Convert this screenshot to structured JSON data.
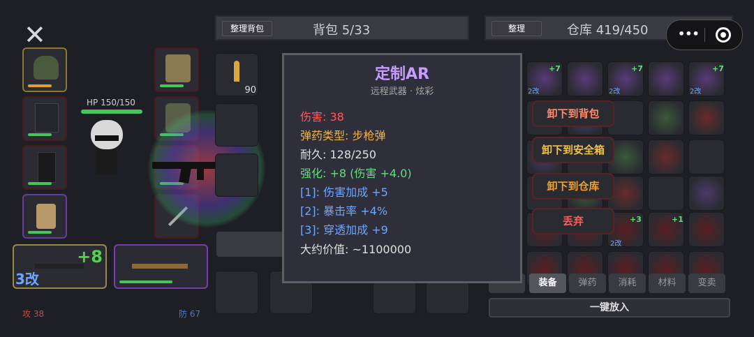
{
  "close_label": "✕",
  "hp_text": "HP 150/150",
  "hp_fraction": 1.0,
  "attack_text": "攻 38",
  "defense_text": "防 67",
  "weapon_slot1": {
    "upgrade": "+8",
    "mods": "3改"
  },
  "backpack": {
    "sort_label": "整理背包",
    "title": "背包 5/33",
    "ammo_count": "90"
  },
  "warehouse": {
    "sort_label": "整理",
    "title": "仓库 419/450"
  },
  "miniapp_more": "•••",
  "tooltip": {
    "name": "定制AR",
    "subtitle": "远程武器 · 炫彩",
    "damage": "伤害: 38",
    "ammo_type": "弹药类型: 步枪弹",
    "durability": "耐久: 128/250",
    "enhance": "强化: +8 (伤害 +4.0)",
    "mod1": "[1]: 伤害加成 +5",
    "mod2": "[2]: 暴击率 +4%",
    "mod3": "[3]: 穿透加成 +9",
    "value": "大约价值: ~1100000"
  },
  "context_menu": {
    "to_backpack": "卸下到背包",
    "to_safebox": "卸下到安全箱",
    "to_warehouse": "卸下到仓库",
    "discard": "丢弃"
  },
  "warehouse_badges": {
    "b1": "+7",
    "b2": "+7",
    "b3": "+7",
    "m1": "2改",
    "m2": "2改",
    "m3": "2改",
    "r1": "+3",
    "r2": "+1",
    "m4": "2改"
  },
  "tabs": [
    "装备",
    "弹药",
    "消耗",
    "材料",
    "变卖"
  ],
  "put_all_label": "一键放入",
  "colors": {
    "accent_purple": "#c79bff",
    "damage_red": "#ff5a5a",
    "ammo_orange": "#f0b24a",
    "enhance_green": "#5fe07a",
    "mod_blue": "#6fa6ff",
    "upgrade_green": "#4fd34a"
  }
}
